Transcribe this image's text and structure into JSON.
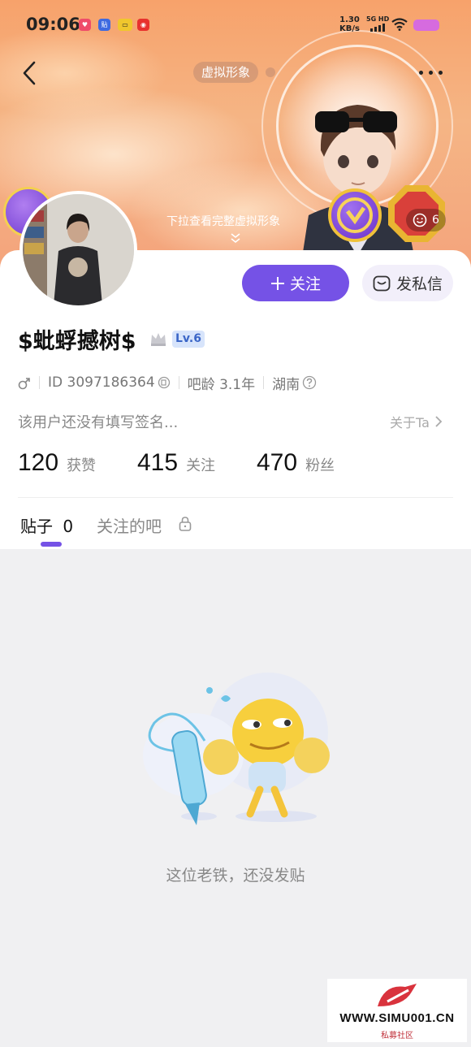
{
  "status_bar": {
    "time": "09:06",
    "net_speed_value": "1.30",
    "net_speed_unit": "KB/s",
    "signal_label": "5G HD"
  },
  "header": {
    "avatar_tag": "虚拟形象",
    "pull_hint": "下拉查看完整虚拟形象",
    "mood_count": "6"
  },
  "profile": {
    "nickname": "$蚍蜉撼树$",
    "level": "Lv.6",
    "id_text": "ID 3097186364",
    "age_text": "吧龄 3.1年",
    "region": "湖南",
    "signature": "该用户还没有填写签名...",
    "about_label": "关于Ta"
  },
  "actions": {
    "follow_label": "关注",
    "message_label": "发私信"
  },
  "stats": [
    {
      "value": "120",
      "label": "获赞"
    },
    {
      "value": "415",
      "label": "关注"
    },
    {
      "value": "470",
      "label": "粉丝"
    }
  ],
  "tabs": {
    "posts_label": "贴子",
    "posts_count": "0",
    "followed_bars_label": "关注的吧"
  },
  "empty_state": {
    "text": "这位老铁，还没发贴"
  },
  "watermark": {
    "url": "WWW.SIMU001.CN",
    "subtitle": "私募社区"
  },
  "colors": {
    "accent": "#7552e6",
    "banner": "#f5a877",
    "level_badge": "#d7e4fb"
  }
}
